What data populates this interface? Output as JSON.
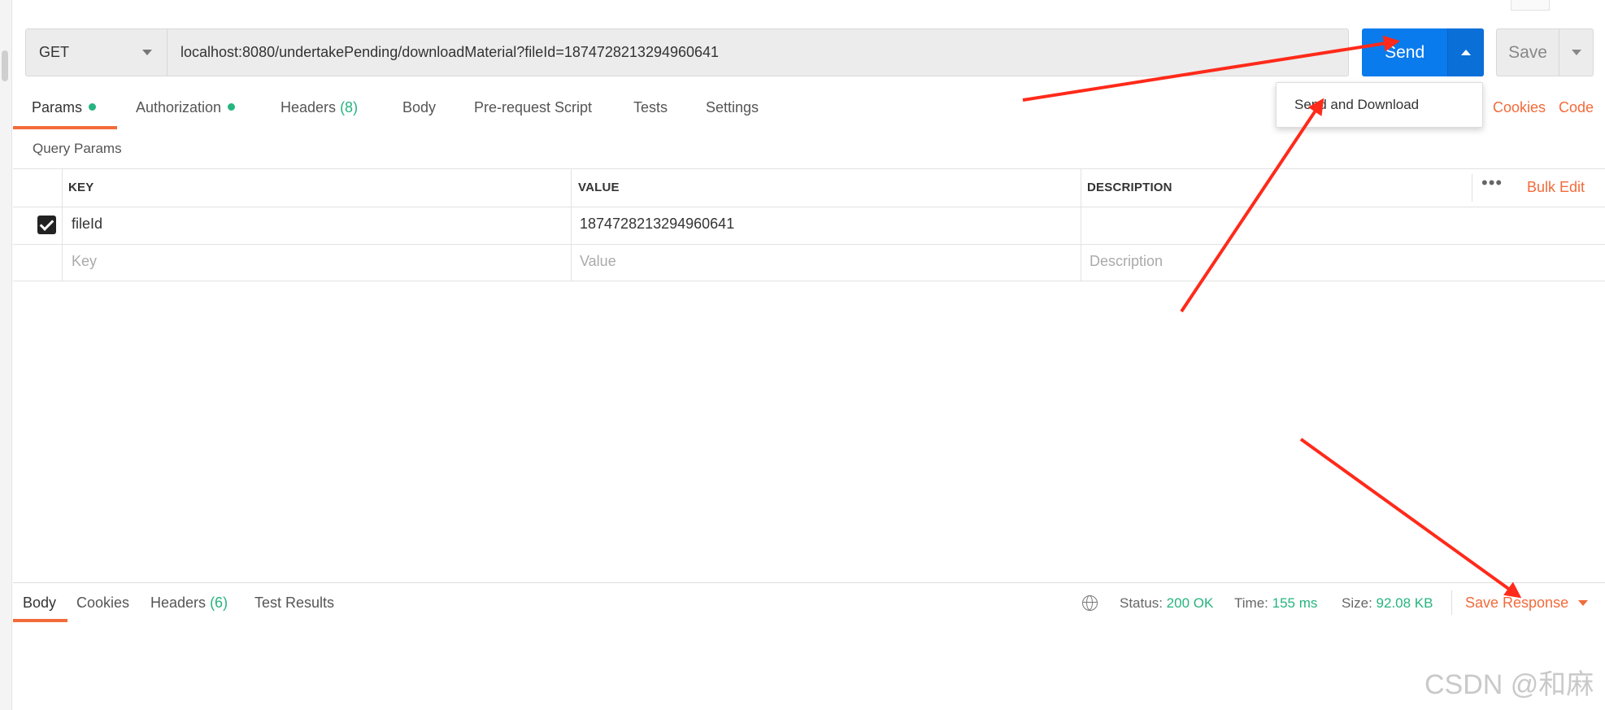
{
  "request": {
    "method": "GET",
    "url": "localhost:8080/undertakePending/downloadMaterial?fileId=1874728213294960641",
    "send_label": "Send",
    "save_label": "Save",
    "send_menu_item": "Send and Download"
  },
  "tabs": {
    "params": "Params",
    "authorization": "Authorization",
    "headers": "Headers",
    "headers_count": "(8)",
    "body": "Body",
    "pre_request": "Pre-request Script",
    "tests": "Tests",
    "settings": "Settings",
    "cookies": "Cookies",
    "code": "Code"
  },
  "params": {
    "section_title": "Query Params",
    "headers": [
      "KEY",
      "VALUE",
      "DESCRIPTION"
    ],
    "bulk_edit": "Bulk Edit",
    "more": "•••",
    "rows": [
      {
        "key": "fileId",
        "value": "1874728213294960641",
        "description": "",
        "checked": true
      }
    ],
    "placeholders": {
      "key": "Key",
      "value": "Value",
      "description": "Description"
    }
  },
  "response": {
    "tabs": {
      "body": "Body",
      "cookies": "Cookies",
      "headers": "Headers",
      "headers_count": "(6)",
      "test_results": "Test Results"
    },
    "status_label": "Status:",
    "status_value": "200 OK",
    "time_label": "Time:",
    "time_value": "155 ms",
    "size_label": "Size:",
    "size_value": "92.08 KB",
    "save_response": "Save Response"
  },
  "watermark": "CSDN @和麻",
  "colors": {
    "accent_orange": "#f26b3a",
    "send_blue": "#097bed",
    "success_green": "#26b47f",
    "annotation_red": "#ff2a1a"
  }
}
